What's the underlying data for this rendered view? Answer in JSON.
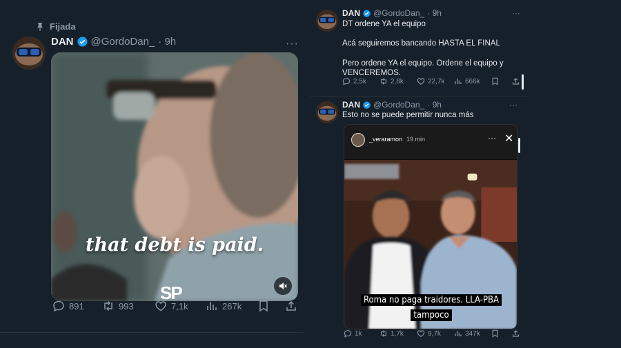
{
  "left": {
    "pinned_label": "Fijada",
    "name": "DAN",
    "handle": "@GordoDan_",
    "time": "· 9h",
    "video_caption": "that debt is paid.",
    "watermark": "SP",
    "stats": {
      "replies": "891",
      "retweets": "993",
      "likes": "7,1k",
      "views": "267k"
    }
  },
  "right": {
    "tweet1": {
      "name": "DAN",
      "handle": "@GordoDan_",
      "time": "· 9h",
      "line1": "DT ordene YA el equipo",
      "line2": "Acá seguiremos bancando HASTA EL FINAL",
      "line3": "Pero ordene YA el equipo. Ordene el equipo y",
      "line4": "VENCEREMOS.",
      "stats": {
        "replies": "2,5k",
        "retweets": "2,8k",
        "likes": "22,7k",
        "views": "666k"
      }
    },
    "tweet2": {
      "name": "DAN",
      "handle": "@GordoDan_",
      "time": "· 9h",
      "text": "Esto no se puede permitir nunca más",
      "story_user": "_veraramon",
      "story_time": "19 min",
      "story_caption": "Roma no paga traidores. LLA-PBA tampoco",
      "stats": {
        "replies": "1k",
        "retweets": "1,7k",
        "likes": "9,7k",
        "views": "347k"
      }
    }
  },
  "colors": {
    "background": "#15202b",
    "text": "#e7e9ea",
    "muted": "#8b98a5",
    "verified": "#1d9bf0"
  },
  "icons": [
    "pin-icon",
    "verified-icon",
    "more-icon",
    "reply-icon",
    "retweet-icon",
    "like-icon",
    "views-icon",
    "bookmark-icon",
    "share-icon",
    "mute-icon",
    "close-icon"
  ]
}
